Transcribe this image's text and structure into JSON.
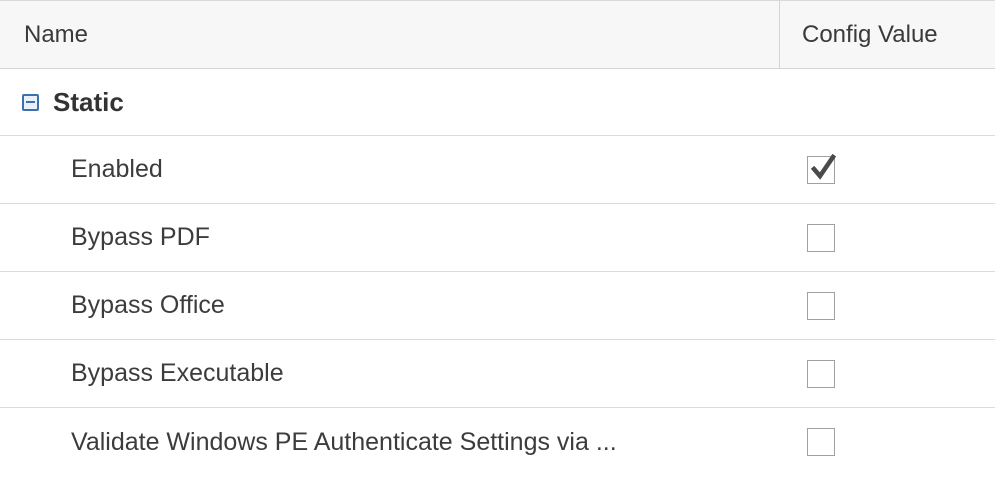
{
  "table": {
    "columns": {
      "name": "Name",
      "config_value": "Config Value"
    },
    "group": {
      "label": "Static",
      "expanded": true,
      "toggle_icon": "minus-square-icon"
    },
    "rows": [
      {
        "name": "Enabled",
        "checked": true
      },
      {
        "name": "Bypass PDF",
        "checked": false
      },
      {
        "name": "Bypass Office",
        "checked": false
      },
      {
        "name": "Bypass Executable",
        "checked": false
      },
      {
        "name": "Validate Windows PE Authenticate Settings via ...",
        "checked": false
      }
    ]
  },
  "colors": {
    "accent": "#3d6fae",
    "header_bg": "#f7f7f7",
    "border": "#dcdcdc"
  }
}
